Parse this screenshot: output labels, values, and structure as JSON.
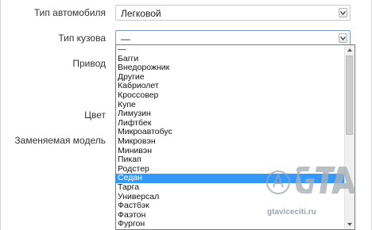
{
  "form": {
    "car_type_label": "Тип автомобиля",
    "car_type_value": "Легковой",
    "body_type_label": "Тип кузова",
    "body_type_value": "—",
    "drive_label": "Привод",
    "color_label": "Цвет",
    "replaced_model_label": "Заменяемая модель"
  },
  "dropdown": {
    "options": [
      "—",
      "Багги",
      "Внедорожник",
      "Другие",
      "Кабриолет",
      "Кроссовер",
      "Купе",
      "Лимузин",
      "Лифтбек",
      "Микроавтобус",
      "Микровэн",
      "Минивэн",
      "Пикап",
      "Родстер",
      "Седан",
      "Тарга",
      "Универсал",
      "Фастбэк",
      "Фаэтон",
      "Фургон"
    ],
    "selected": "Седан"
  },
  "watermark": {
    "text": "gtaviceciti.ru"
  },
  "colors": {
    "highlight": "#3399ff",
    "border": "#c9c9c9"
  }
}
